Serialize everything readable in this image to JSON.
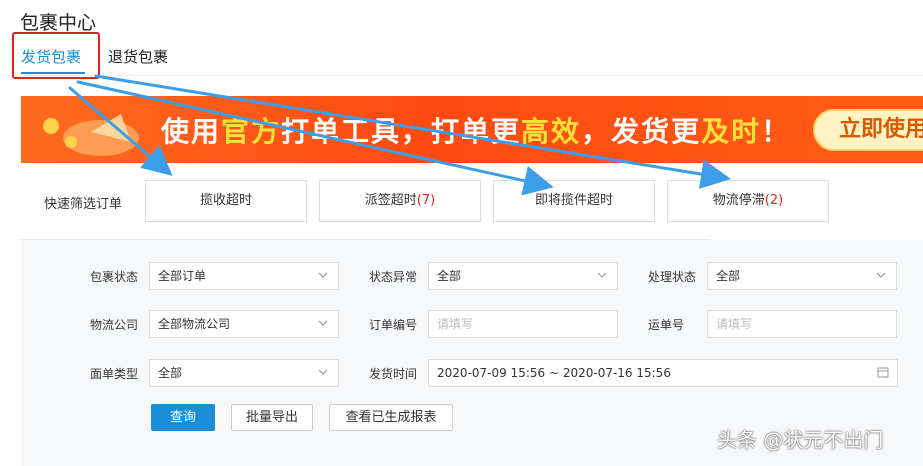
{
  "page": {
    "title": "包裹中心"
  },
  "tabs": [
    {
      "label": "发货包裹",
      "active": true
    },
    {
      "label": "退货包裹",
      "active": false
    }
  ],
  "banner": {
    "text_part1": "使用",
    "text_hl1": "官方",
    "text_part2": "打单工具，打单更",
    "text_hl2": "高效",
    "text_part3": "，发货更",
    "text_hl3": "及时",
    "text_part4": "！",
    "cta": "立即使用"
  },
  "quick_filter": {
    "label": "快速筛选订单",
    "items": [
      {
        "label": "揽收超时",
        "count": ""
      },
      {
        "label": "派签超时",
        "count": "(7)"
      },
      {
        "label": "即将揽件超时",
        "count": ""
      },
      {
        "label": "物流停滞",
        "count": "(2)"
      }
    ]
  },
  "form": {
    "package_status": {
      "label": "包裹状态",
      "value": "全部订单"
    },
    "status_abnormal": {
      "label": "状态异常",
      "value": "全部"
    },
    "process_status": {
      "label": "处理状态",
      "value": "全部"
    },
    "logistics_company": {
      "label": "物流公司",
      "value": "全部物流公司"
    },
    "order_no": {
      "label": "订单编号",
      "placeholder": "请填写"
    },
    "tracking_no": {
      "label": "运单号",
      "placeholder": "请填写"
    },
    "waybill_type": {
      "label": "面单类型",
      "value": "全部"
    },
    "ship_time": {
      "label": "发货时间",
      "value": "2020-07-09 15:56 ~ 2020-07-16 15:56"
    }
  },
  "actions": {
    "search": "查询",
    "batch_export": "批量导出",
    "view_reports": "查看已生成报表"
  },
  "watermark": "头条 @状元不出门",
  "colors": {
    "accent": "#1a8fd8",
    "highlight_red": "#e02020",
    "banner_orange": "#ff4a12",
    "annotation_arrow": "#3a9ee8"
  }
}
